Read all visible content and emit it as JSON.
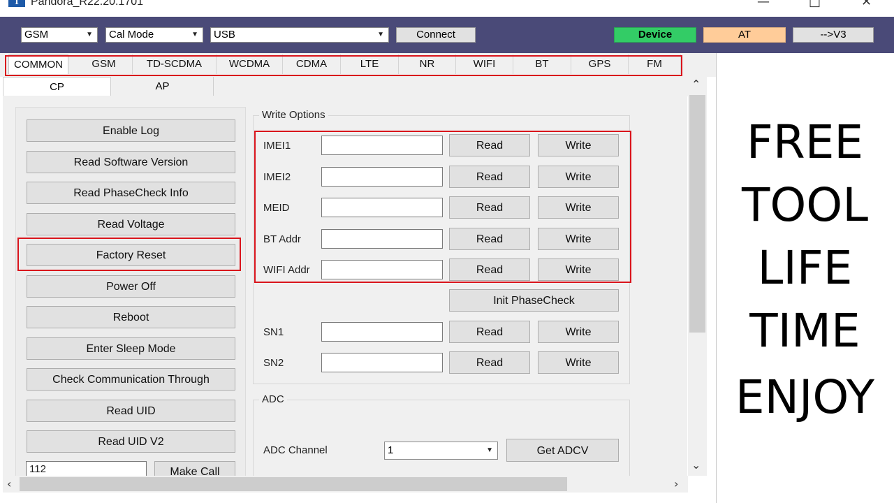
{
  "window": {
    "title": "Pandora_R22.20.1701",
    "icon_letter": "T",
    "controls": {
      "minimize": "—",
      "maximize": "□",
      "close": "✕"
    }
  },
  "toolbar": {
    "mode_select": "GSM",
    "cal_select": "Cal Mode",
    "port_select": "USB",
    "connect_label": "Connect",
    "device_label": "Device",
    "at_label": "AT",
    "v3_label": "-->V3",
    "colors": {
      "bar": "#4a4a78",
      "device": "#33cc66",
      "at": "#ffcc99"
    }
  },
  "tabs": [
    "COMMON",
    "GSM",
    "TD-SCDMA",
    "WCDMA",
    "CDMA",
    "LTE",
    "NR",
    "WIFI",
    "BT",
    "GPS",
    "FM"
  ],
  "subtabs": [
    "CP",
    "AP"
  ],
  "actions": [
    "Enable Log",
    "Read Software Version",
    "Read PhaseCheck Info",
    "Read Voltage",
    "Factory Reset",
    "Power Off",
    "Reboot",
    "Enter Sleep Mode",
    "Check Communication Through",
    "Read UID",
    "Read UID V2"
  ],
  "call": {
    "number_value": "112",
    "make_call_label": "Make Call"
  },
  "write_options": {
    "title": "Write Options",
    "fields": [
      {
        "label": "IMEI1",
        "value": ""
      },
      {
        "label": "IMEI2",
        "value": ""
      },
      {
        "label": "MEID",
        "value": ""
      },
      {
        "label": "BT Addr",
        "value": ""
      },
      {
        "label": "WIFI Addr",
        "value": ""
      }
    ],
    "init_phasecheck_label": "Init PhaseCheck",
    "sn_fields": [
      {
        "label": "SN1",
        "value": ""
      },
      {
        "label": "SN2",
        "value": ""
      }
    ],
    "read_label": "Read",
    "write_label": "Write"
  },
  "adc": {
    "title": "ADC",
    "channel_label": "ADC Channel",
    "channel_value": "1",
    "get_label": "Get ADCV"
  },
  "overlay_lines": [
    "FREE",
    "TOOL",
    "LIFE",
    "TIME",
    "ENJOY"
  ],
  "highlight_color": "#d9141c"
}
